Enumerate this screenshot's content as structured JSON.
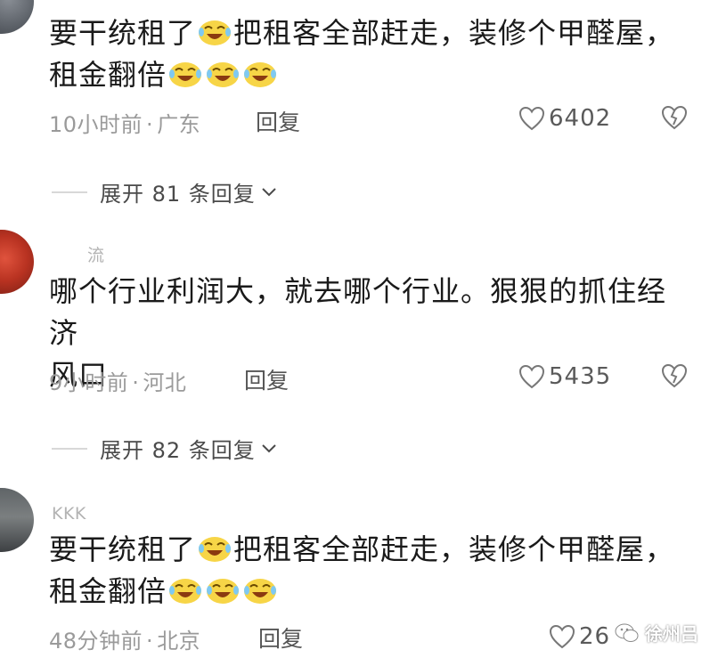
{
  "comments": [
    {
      "username": "",
      "text_line1_a": "要干统租了",
      "text_line1_b": "把租客全部赶走，装修个甲醛屋，",
      "text_line2": "租金翻倍",
      "time": "10小时前",
      "location": "广东",
      "reply_label": "回复",
      "likes": "6402",
      "expand_label": "展开 81 条回复"
    },
    {
      "username": "流",
      "text_line1": "哪个行业利润大，就去哪个行业。狠狠的抓住经济",
      "text_line2": "风口",
      "time": "9小时前",
      "location": "河北",
      "reply_label": "回复",
      "likes": "5435",
      "expand_label": "展开 82 条回复"
    },
    {
      "username": "KKK",
      "text_line1_a": "要干统租了",
      "text_line1_b": "把租客全部赶走，装修个甲醛屋，",
      "text_line2": "租金翻倍",
      "time": "48分钟前",
      "location": "北京",
      "reply_label": "回复",
      "likes": "26"
    }
  ],
  "separator": "·",
  "watermark": "徐州吕",
  "icons": {
    "emoji": "laughing-tears-emoji-icon",
    "like": "heart-outline-icon",
    "dislike": "broken-heart-icon",
    "expand": "chevron-down-icon"
  },
  "colors": {
    "text": "#1a1a1a",
    "meta": "#9a9a9a",
    "emoji": "#f7d547"
  }
}
